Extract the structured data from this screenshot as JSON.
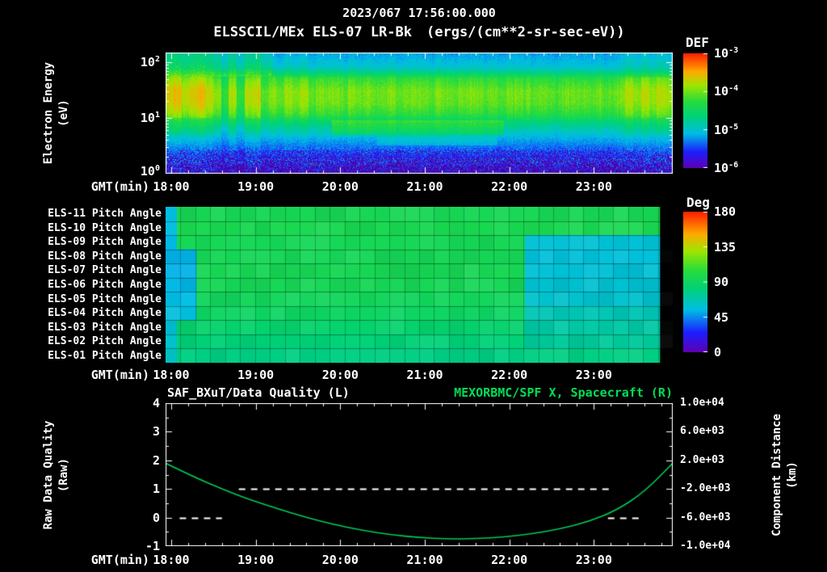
{
  "header": {
    "datetime": "2023/067 17:56:00.000",
    "instrument": "ELSSCIL/MEx ELS-07 LR-Bk",
    "units": "(ergs/(cm**2-sr-sec-eV))"
  },
  "time_axis": {
    "label": "GMT(min)",
    "start": "17:56",
    "end": "23:56",
    "span_minutes": 360,
    "ticks": [
      "18:00",
      "19:00",
      "20:00",
      "21:00",
      "22:00",
      "23:00"
    ]
  },
  "colors": {
    "background": "#000000",
    "axis": "#ffffff",
    "text": "#ffffff"
  },
  "chart_data": [
    {
      "type": "heatmap",
      "title": "ELSSCIL/MEx ELS-07 LR-Bk",
      "units_label": "(ergs/(cm**2-sr-sec-eV))",
      "xlabel": "GMT(min)",
      "x_ticks": [
        "18:00",
        "19:00",
        "20:00",
        "21:00",
        "22:00",
        "23:00"
      ],
      "ylabel": "Electron Energy",
      "ylabel_units": "(eV)",
      "yscale": "log",
      "y_range_ev": [
        1,
        150
      ],
      "y_tick_exponents": [
        2,
        1,
        0
      ],
      "value_label": "DEF",
      "value_scale": "log10",
      "value_range": [
        -6,
        -3
      ],
      "colorbar_tick_exponents": [
        -3,
        -4,
        -5,
        -6
      ],
      "profile_energy_ev": [
        1,
        1.8,
        3,
        5,
        8,
        12,
        18,
        30,
        50,
        80,
        120,
        150
      ],
      "profile_log10_flux": [
        -5.9,
        -5.6,
        -5.35,
        -5.05,
        -4.7,
        -4.3,
        -4.1,
        -4.05,
        -4.3,
        -5.0,
        -5.15,
        -5.2
      ],
      "column_mod": [
        0.42,
        0.5,
        0.3,
        0.46,
        0.52,
        0.34,
        0.18,
        -0.2,
        0.26,
        -0.15,
        0.3,
        0.36,
        -0.04,
        0.16,
        0.04,
        0.2,
        0.1,
        0.24,
        0,
        0.14,
        0.05,
        0.1,
        0,
        0.12,
        0.04,
        0.1,
        0,
        0.06,
        0.1,
        0,
        0.05,
        0.1,
        0.04,
        0,
        0.1,
        0.05,
        0,
        0.06,
        0.1,
        0.04,
        0,
        0.05,
        0,
        0.05,
        0.1,
        0.04,
        0,
        0.05,
        0,
        -0.05,
        0.05,
        0,
        0.04,
        0,
        0.05,
        -0.05,
        0,
        0.1,
        0.28,
        0.14,
        0.34,
        0.2,
        0.3,
        0.24
      ],
      "features": [
        {
          "t_min": [
            118,
            240
          ],
          "energy_ev": [
            5,
            9
          ],
          "delta": 0.38
        },
        {
          "t_min": [
            150,
            235
          ],
          "energy_ev": [
            3.2,
            5
          ],
          "delta": 0.15
        },
        {
          "t_min": [
            0,
            75
          ],
          "energy_ev": [
            55,
            150
          ],
          "delta": 0.2,
          "speckle": 0.4
        }
      ]
    },
    {
      "type": "heatmap",
      "colorbar_label": "Deg",
      "colorbar_ticks": [
        180,
        135,
        90,
        45,
        0
      ],
      "value_range_deg": [
        0,
        180
      ],
      "xlabel": "GMT(min)",
      "rows": [
        {
          "label": "ELS-11 Pitch Angle",
          "segments": [
            [
              0,
              8,
              55
            ],
            [
              8,
              351,
              95
            ],
            [
              351,
              360,
              null
            ]
          ]
        },
        {
          "label": "ELS-10 Pitch Angle",
          "segments": [
            [
              0,
              8,
              55
            ],
            [
              8,
              351,
              96
            ],
            [
              351,
              360,
              null
            ]
          ]
        },
        {
          "label": "ELS-09 Pitch Angle",
          "segments": [
            [
              0,
              8,
              53
            ],
            [
              8,
              255,
              94
            ],
            [
              255,
              351,
              58
            ],
            [
              351,
              360,
              null
            ]
          ]
        },
        {
          "label": "ELS-08 Pitch Angle",
          "segments": [
            [
              0,
              22,
              52
            ],
            [
              22,
              255,
              94
            ],
            [
              255,
              351,
              57
            ],
            [
              351,
              360,
              null
            ]
          ]
        },
        {
          "label": "ELS-07 Pitch Angle",
          "segments": [
            [
              0,
              22,
              52
            ],
            [
              22,
              255,
              95
            ],
            [
              255,
              351,
              58
            ],
            [
              351,
              360,
              null
            ]
          ]
        },
        {
          "label": "ELS-06 Pitch Angle",
          "segments": [
            [
              0,
              22,
              53
            ],
            [
              22,
              255,
              94
            ],
            [
              255,
              351,
              59
            ],
            [
              351,
              360,
              null
            ]
          ]
        },
        {
          "label": "ELS-05 Pitch Angle",
          "segments": [
            [
              0,
              22,
              54
            ],
            [
              22,
              255,
              92
            ],
            [
              255,
              351,
              60
            ],
            [
              351,
              360,
              null
            ]
          ]
        },
        {
          "label": "ELS-04 Pitch Angle",
          "segments": [
            [
              0,
              22,
              56
            ],
            [
              22,
              255,
              89
            ],
            [
              255,
              351,
              66
            ],
            [
              351,
              360,
              null
            ]
          ]
        },
        {
          "label": "ELS-03 Pitch Angle",
          "segments": [
            [
              0,
              8,
              58
            ],
            [
              8,
              255,
              85
            ],
            [
              255,
              351,
              70
            ],
            [
              351,
              360,
              null
            ]
          ]
        },
        {
          "label": "ELS-02 Pitch Angle",
          "segments": [
            [
              0,
              8,
              60
            ],
            [
              8,
              255,
              81
            ],
            [
              255,
              351,
              72
            ],
            [
              351,
              360,
              null
            ]
          ]
        },
        {
          "label": "ELS-01 Pitch Angle",
          "segments": [
            [
              0,
              8,
              62
            ],
            [
              8,
              351,
              78
            ],
            [
              351,
              360,
              null
            ]
          ]
        }
      ]
    },
    {
      "type": "line",
      "title_left": "SAF_BXuT/Data Quality (L)",
      "title_right": "MEXORBMC/SPF X, Spacecraft (R)",
      "title_right_color": "#00dd55",
      "xlabel": "GMT(min)",
      "ylabel_left": "Raw Data Quality",
      "ylabel_left_units": "(Raw)",
      "y_ticks_left": [
        4,
        3,
        2,
        1,
        0,
        -1
      ],
      "y_range_left": [
        -1,
        4
      ],
      "ylabel_right": "Component Distance",
      "ylabel_right_units": "(km)",
      "y_ticks_right": [
        "1.0e+04",
        "6.0e+03",
        "2.0e+03",
        "-2.0e+03",
        "-6.0e+03",
        "-1.0e+04"
      ],
      "y_range_right": [
        -10000,
        10000
      ],
      "series": [
        {
          "name": "MEXORBMC/SPF X, Spacecraft",
          "axis": "right",
          "style": "solid",
          "color": "#00cc55",
          "t_min": [
            0,
            20,
            40,
            60,
            80,
            100,
            120,
            140,
            160,
            180,
            200,
            220,
            240,
            260,
            280,
            300,
            320,
            340,
            360
          ],
          "values_km": [
            1600,
            -320,
            -2000,
            -3520,
            -4800,
            -6000,
            -7000,
            -7800,
            -8400,
            -8800,
            -9000,
            -8960,
            -8720,
            -8280,
            -7600,
            -6600,
            -5000,
            -2400,
            1600
          ]
        },
        {
          "name": "SAF_BXuT/Data Quality",
          "axis": "left",
          "style": "dashed",
          "color": "#ffffff",
          "segments": [
            {
              "t_min": [
                10,
                40
              ],
              "value": 0
            },
            {
              "t_min": [
                52,
                318
              ],
              "value": 1
            },
            {
              "t_min": [
                314,
                338
              ],
              "value": 0
            }
          ]
        }
      ]
    }
  ]
}
